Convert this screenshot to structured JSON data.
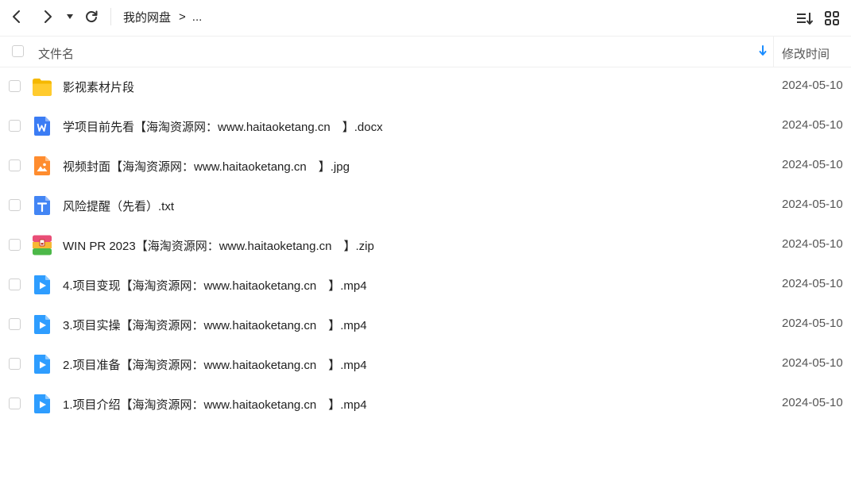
{
  "toolbar": {
    "back_icon": "chevron-left-icon",
    "forward_icon": "chevron-right-icon",
    "history_icon": "caret-down-icon",
    "refresh_icon": "refresh-icon",
    "sort_icon": "sort-list-icon",
    "grid_icon": "grid-view-icon"
  },
  "breadcrumb": {
    "root": "我的网盘",
    "separator": ">",
    "more": "..."
  },
  "table": {
    "header_name": "文件名",
    "header_time": "修改时间",
    "sort_icon": "sort-down-arrow-icon",
    "sort_color": "#1a8cff"
  },
  "files": [
    {
      "name": "影视素材片段",
      "modified": "2024-05-10",
      "icon": "folder-icon"
    },
    {
      "name": "学项目前先看【海淘资源网：www.haitaoketang.cn　】.docx",
      "modified": "2024-05-10",
      "icon": "word-doc-icon"
    },
    {
      "name": "视频封面【海淘资源网：www.haitaoketang.cn　】.jpg",
      "modified": "2024-05-10",
      "icon": "image-file-icon"
    },
    {
      "name": "风险提醒（先看）.txt",
      "modified": "2024-05-10",
      "icon": "text-file-icon"
    },
    {
      "name": "WIN PR 2023【海淘资源网：www.haitaoketang.cn　】.zip",
      "modified": "2024-05-10",
      "icon": "zip-archive-icon"
    },
    {
      "name": "4.项目变现【海淘资源网：www.haitaoketang.cn　】.mp4",
      "modified": "2024-05-10",
      "icon": "video-file-icon"
    },
    {
      "name": "3.项目实操【海淘资源网：www.haitaoketang.cn　】.mp4",
      "modified": "2024-05-10",
      "icon": "video-file-icon"
    },
    {
      "name": "2.项目准备【海淘资源网：www.haitaoketang.cn　】.mp4",
      "modified": "2024-05-10",
      "icon": "video-file-icon"
    },
    {
      "name": "1.项目介绍【海淘资源网：www.haitaoketang.cn　】.mp4",
      "modified": "2024-05-10",
      "icon": "video-file-icon"
    }
  ]
}
